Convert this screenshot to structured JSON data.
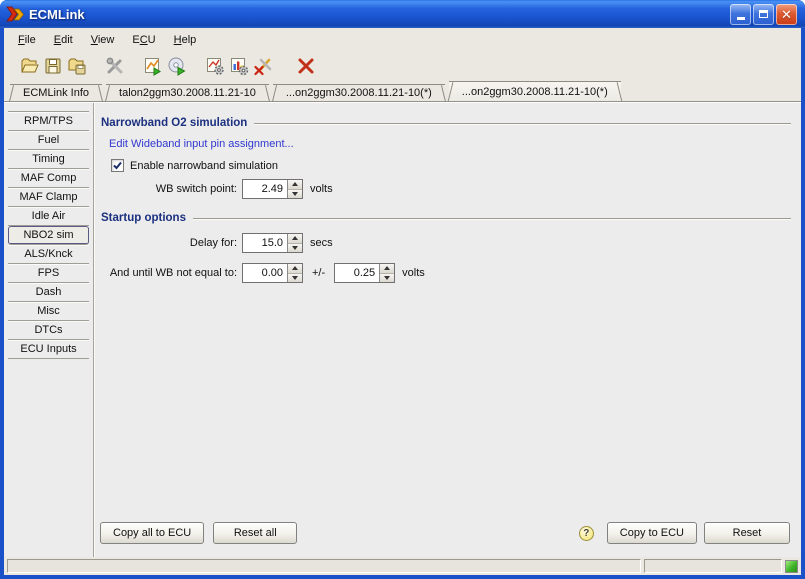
{
  "window": {
    "title": "ECMLink"
  },
  "titlebar": {
    "icons": [
      "app-logo-icon",
      "minimize-icon",
      "maximize-icon",
      "close-icon"
    ]
  },
  "menu": {
    "items": [
      {
        "pre": "",
        "u": "F",
        "rest": "ile"
      },
      {
        "pre": "",
        "u": "E",
        "rest": "dit"
      },
      {
        "pre": "",
        "u": "V",
        "rest": "iew"
      },
      {
        "pre": "E",
        "u": "C",
        "rest": "U"
      },
      {
        "pre": "",
        "u": "H",
        "rest": "elp"
      }
    ]
  },
  "toolbar": {
    "icons": [
      "open-folder-icon",
      "save-icon",
      "folder-save-icon",
      "tools-icon",
      "chart-export-icon",
      "cd-export-icon",
      "chart-gear-icon",
      "chart-bars-gear-icon",
      "tools-delete-icon",
      "red-x-icon"
    ]
  },
  "tabs": [
    {
      "label": "ECMLink Info",
      "active": false
    },
    {
      "label": "talon2ggm30.2008.11.21-10",
      "active": false
    },
    {
      "label": "...on2ggm30.2008.11.21-10(*)",
      "active": false
    },
    {
      "label": "...on2ggm30.2008.11.21-10(*)",
      "active": true
    }
  ],
  "sidebar": {
    "items": [
      {
        "label": "RPM/TPS",
        "selected": false
      },
      {
        "label": "Fuel",
        "selected": false
      },
      {
        "label": "Timing",
        "selected": false
      },
      {
        "label": "MAF Comp",
        "selected": false
      },
      {
        "label": "MAF Clamp",
        "selected": false
      },
      {
        "label": "Idle Air",
        "selected": false
      },
      {
        "label": "NBO2 sim",
        "selected": true
      },
      {
        "label": "ALS/Knck",
        "selected": false
      },
      {
        "label": "FPS",
        "selected": false
      },
      {
        "label": "Dash",
        "selected": false
      },
      {
        "label": "Misc",
        "selected": false
      },
      {
        "label": "DTCs",
        "selected": false
      },
      {
        "label": "ECU Inputs",
        "selected": false
      }
    ]
  },
  "panel": {
    "narrowband": {
      "title": "Narrowband O2 simulation",
      "link": "Edit Wideband input pin assignment...",
      "checkbox_label": "Enable narrowband simulation",
      "checkbox_checked": true,
      "wb_label": "WB switch point:",
      "wb_value": "2.49",
      "wb_unit": "volts"
    },
    "startup": {
      "title": "Startup options",
      "delay_label": "Delay for:",
      "delay_value": "15.0",
      "delay_unit": "secs",
      "until_label": "And until WB not equal to:",
      "until_value": "0.00",
      "plusminus": "+/-",
      "tolerance_value": "0.25",
      "until_unit": "volts"
    },
    "buttons": {
      "copy_all": "Copy all to ECU",
      "reset_all": "Reset all",
      "help": "?",
      "copy": "Copy to ECU",
      "reset": "Reset"
    }
  },
  "statusbar": {
    "left_text": "",
    "right_text": "",
    "indicator": "green"
  },
  "colors": {
    "titlebar_blue": "#2563dd",
    "link_blue": "#3038cf",
    "section_heading_blue": "#1c3080",
    "status_green": "#3fb428",
    "close_red": "#c93c16",
    "chrome_gray": "#eae8e1",
    "pane_gray": "#ececec"
  }
}
